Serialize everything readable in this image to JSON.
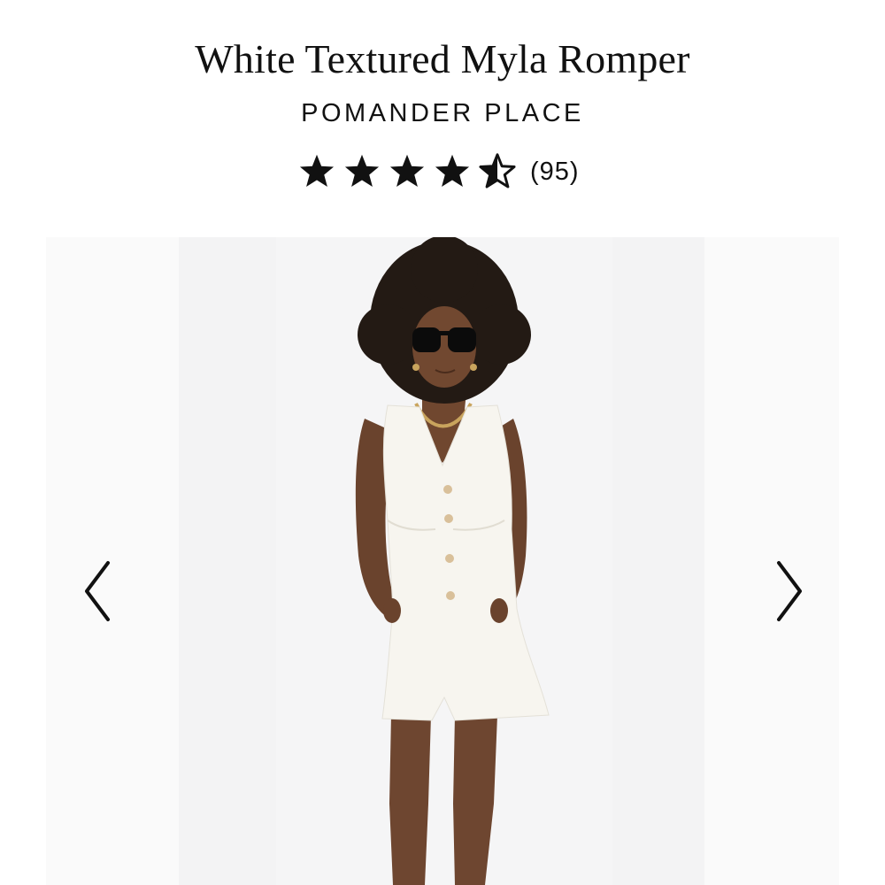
{
  "product": {
    "title": "White Textured Myla Romper",
    "brand": "POMANDER PLACE",
    "rating": {
      "value": 4.5,
      "max": 5,
      "review_count": "(95)",
      "icon": "star-icon"
    }
  },
  "carousel": {
    "prev_icon": "chevron-left-icon",
    "next_icon": "chevron-right-icon"
  },
  "colors": {
    "text": "#111111",
    "image_background": "#f3f3f4",
    "romper": "#f7f5ef"
  }
}
